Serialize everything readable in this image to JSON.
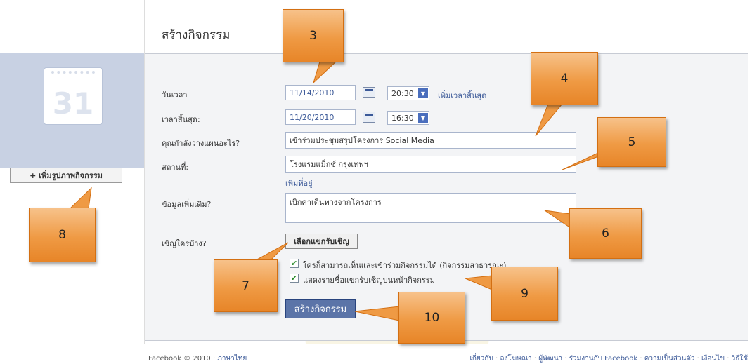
{
  "page": {
    "title": "สร้างกิจกรรม"
  },
  "sidebar": {
    "calendar_number": "31",
    "add_photo_label": "+ เพิ่มรูปภาพกิจกรรม"
  },
  "form": {
    "when_label": "วันเวลา",
    "start_date": "11/14/2010",
    "start_time": "20:30",
    "add_end_time_link": "เพิ่มเวลาสิ้นสุด",
    "end_label": "เวลาสิ้นสุด:",
    "end_date": "11/20/2010",
    "end_time": "16:30",
    "what_label": "คุณกำลังวางแผนอะไร?",
    "what_value": "เข้าร่วมประชุมสรุปโครงการ Social Media",
    "where_label": "สถานที่:",
    "where_value": "โรงแรมแม็กซ์ กรุงเทพฯ",
    "add_address_link": "เพิ่มที่อยู่",
    "more_info_label": "ข้อมูลเพิ่มเติม?",
    "more_info_value": "เบิกค่าเดินทางจากโครงการ",
    "who_label": "เชิญใครบ้าง?",
    "select_guests_button": "เลือกแขกรับเชิญ",
    "checkbox_public_label": "ใครก็สามารถเห็นและเข้าร่วมกิจกรรมได้ (กิจกรรมสาธารณะ)",
    "checkbox_public_checked": true,
    "checkbox_guestlist_label": "แสดงรายชื่อแขกรับเชิญบนหน้ากิจกรรม",
    "checkbox_guestlist_checked": true,
    "submit_button": "สร้างกิจกรรม"
  },
  "footer": {
    "copyright": "Facebook © 2010 ·",
    "language": "ภาษาไทย",
    "links": [
      "เกี่ยวกับ",
      "ลงโฆษณา",
      "ผู้พัฒนา",
      "ร่วมงานกับ Facebook",
      "ความเป็นส่วนตัว",
      "เงื่อนไข",
      "วิธีใช้"
    ]
  },
  "callouts": [
    "3",
    "4",
    "5",
    "6",
    "7",
    "8",
    "9",
    "10"
  ],
  "icons": {
    "calendar": "calendar-icon",
    "dropdown": "chevron-down-icon",
    "check": "checkmark-icon"
  }
}
